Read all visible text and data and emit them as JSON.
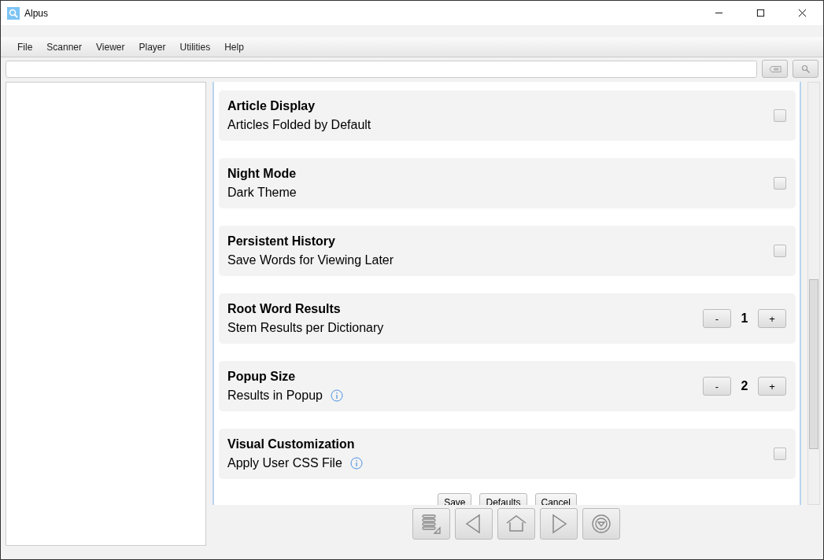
{
  "window": {
    "title": "Alpus"
  },
  "menu": [
    "File",
    "Scanner",
    "Viewer",
    "Player",
    "Utilities",
    "Help"
  ],
  "settings": [
    {
      "kind": "checkbox",
      "title": "Article Display",
      "description": "Articles Folded by Default",
      "info": false,
      "checked": false
    },
    {
      "kind": "checkbox",
      "title": "Night Mode",
      "description": "Dark Theme",
      "info": false,
      "checked": false
    },
    {
      "kind": "checkbox",
      "title": "Persistent History",
      "description": "Save Words for Viewing Later",
      "info": false,
      "checked": false
    },
    {
      "kind": "stepper",
      "title": "Root Word Results",
      "description": "Stem Results per Dictionary",
      "info": false,
      "value": "1",
      "minus": "-",
      "plus": "+"
    },
    {
      "kind": "stepper",
      "title": "Popup Size",
      "description": "Results in Popup",
      "info": true,
      "value": "2",
      "minus": "-",
      "plus": "+"
    },
    {
      "kind": "checkbox",
      "title": "Visual Customization",
      "description": "Apply User CSS File",
      "info": true,
      "checked": false
    }
  ],
  "buttons": [
    "Save",
    "Defaults",
    "Cancel"
  ]
}
